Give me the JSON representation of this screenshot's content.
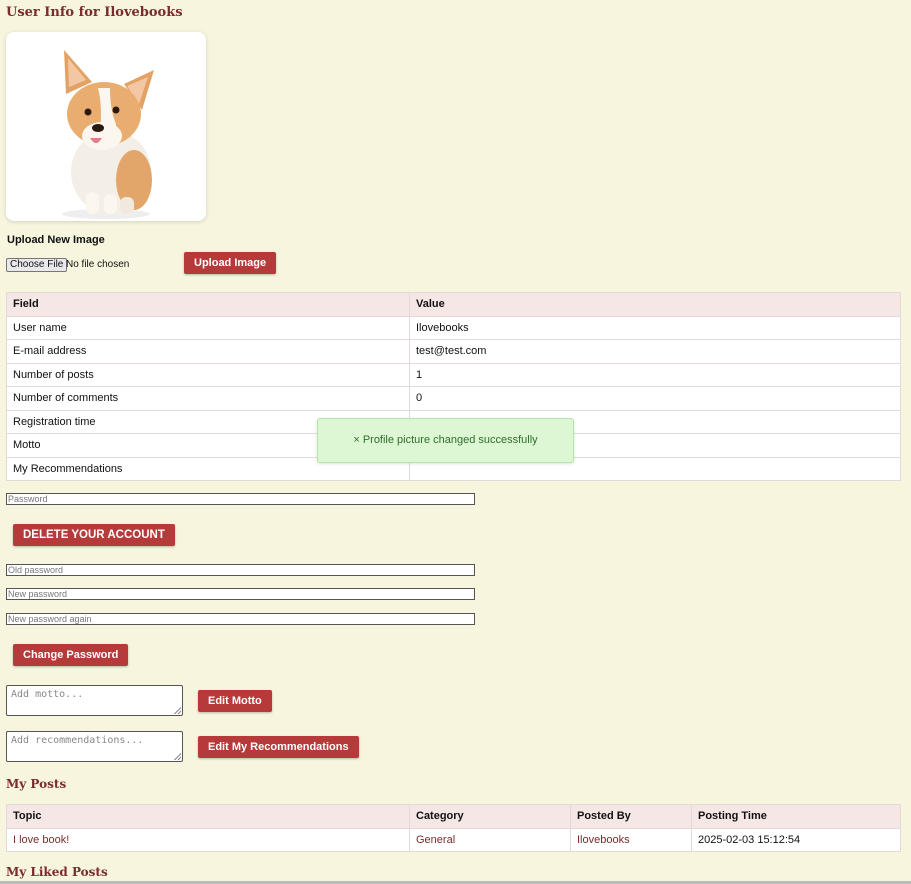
{
  "header": {
    "title": "User Info for Ilovebooks"
  },
  "upload": {
    "label": "Upload New Image",
    "choose_file": "Choose File",
    "no_file": "No file chosen",
    "button": "Upload Image"
  },
  "info_table": {
    "headers": [
      "Field",
      "Value"
    ],
    "rows": [
      {
        "field": "User name",
        "value": "Ilovebooks"
      },
      {
        "field": "E-mail address",
        "value": "test@test.com"
      },
      {
        "field": "Number of posts",
        "value": "1"
      },
      {
        "field": "Number of comments",
        "value": "0"
      },
      {
        "field": "Registration time",
        "value": ""
      },
      {
        "field": "Motto",
        "value": ""
      },
      {
        "field": "My Recommendations",
        "value": ""
      }
    ]
  },
  "toast": {
    "icon": "×",
    "message": "Profile picture changed successfully"
  },
  "delete_account": {
    "password_placeholder": "Password",
    "button": "DELETE YOUR ACCOUNT"
  },
  "change_password": {
    "old_placeholder": "Old password",
    "new_placeholder": "New password",
    "again_placeholder": "New password again",
    "button": "Change Password"
  },
  "motto": {
    "placeholder": "Add motto...",
    "button": "Edit Motto"
  },
  "recommendations": {
    "placeholder": "Add recommendations...",
    "button": "Edit My Recommendations"
  },
  "my_posts": {
    "heading": "My Posts",
    "headers": [
      "Topic",
      "Category",
      "Posted By",
      "Posting Time"
    ],
    "rows": [
      {
        "topic": "I love book!",
        "category": "General",
        "posted_by": "Ilovebooks",
        "time": "2025-02-03 15:12:54"
      }
    ]
  },
  "liked_posts": {
    "heading": "My Liked Posts"
  },
  "colors": {
    "accent": "#b73a3a",
    "heading": "#7b2b2b",
    "background": "#f7f5de",
    "toast_bg": "#ddf7d4"
  }
}
